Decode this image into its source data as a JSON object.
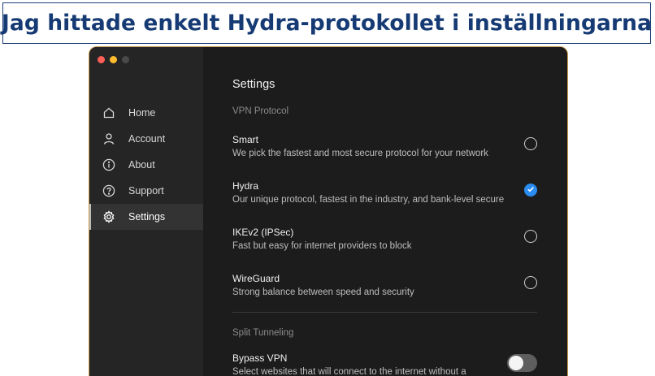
{
  "caption": "Jag hittade enkelt Hydra-protokollet i inställningarna",
  "sidebar": {
    "items": [
      {
        "label": "Home",
        "icon": "home-icon"
      },
      {
        "label": "Account",
        "icon": "person-icon"
      },
      {
        "label": "About",
        "icon": "info-icon"
      },
      {
        "label": "Support",
        "icon": "help-icon"
      },
      {
        "label": "Settings",
        "icon": "gear-icon",
        "active": true
      }
    ]
  },
  "main": {
    "title": "Settings",
    "vpn_protocol": {
      "label": "VPN Protocol",
      "options": [
        {
          "name": "Smart",
          "desc": "We pick the fastest and most secure protocol for your network",
          "selected": false
        },
        {
          "name": "Hydra",
          "desc": "Our unique protocol, fastest in the industry, and bank-level secure",
          "selected": true
        },
        {
          "name": "IKEv2 (IPSec)",
          "desc": "Fast but easy for internet providers to block",
          "selected": false
        },
        {
          "name": "WireGuard",
          "desc": "Strong balance between speed and security",
          "selected": false
        }
      ]
    },
    "split_tunneling": {
      "label": "Split Tunneling",
      "bypass": {
        "name": "Bypass VPN",
        "desc": "Select websites that will connect to the internet without a",
        "enabled": false
      }
    }
  },
  "colors": {
    "accent": "#2a8cf0",
    "caption": "#163a73",
    "window_bg": "#1c1c1c",
    "sidebar_bg": "#252525"
  }
}
